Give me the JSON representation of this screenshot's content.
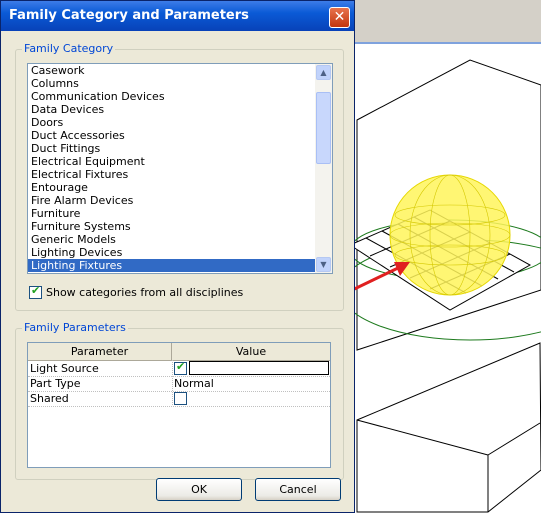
{
  "dialog": {
    "title": "Family Category and Parameters",
    "close_label": "✕"
  },
  "family_category": {
    "group_title": "Family Category",
    "items": [
      "Casework",
      "Columns",
      "Communication Devices",
      "Data Devices",
      "Doors",
      "Duct Accessories",
      "Duct Fittings",
      "Electrical Equipment",
      "Electrical Fixtures",
      "Entourage",
      "Fire Alarm Devices",
      "Furniture",
      "Furniture Systems",
      "Generic Models",
      "Lighting Devices",
      "Lighting Fixtures"
    ],
    "selected": "Lighting Fixtures",
    "show_all_label": "Show categories from all disciplines",
    "show_all_checked": true
  },
  "family_parameters": {
    "group_title": "Family Parameters",
    "columns": [
      "Parameter",
      "Value"
    ],
    "rows": [
      {
        "parameter": "Light Source",
        "value": "",
        "type": "checkbox",
        "checked": true
      },
      {
        "parameter": "Part Type",
        "value": "Normal",
        "type": "text"
      },
      {
        "parameter": "Shared",
        "value": "",
        "type": "checkbox",
        "checked": false
      }
    ]
  },
  "buttons": {
    "ok": "OK",
    "cancel": "Cancel"
  },
  "colors": {
    "titlebar": "#0a5ad6",
    "selection": "#316ac5",
    "highlight": "#e02020",
    "sphere": "#ffff00"
  },
  "icons": {
    "close": "close-icon",
    "scroll_up": "chevron-up-icon",
    "scroll_down": "chevron-down-icon",
    "check": "checkmark-icon"
  }
}
